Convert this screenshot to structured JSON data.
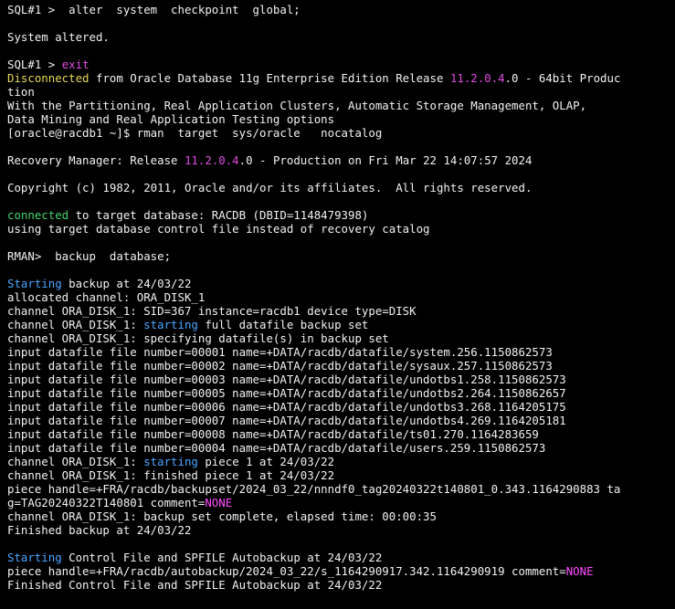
{
  "palette": {
    "background": "#000000",
    "text": "#f2f2f2",
    "yellow": "#e6d85a",
    "magenta": "#e04be0",
    "green": "#48d46f",
    "blue": "#4aa6ff",
    "pink": "#ff4bff"
  },
  "lines": [
    {
      "segments": [
        {
          "text": "SQL#1 >  alter  system  checkpoint  global;"
        }
      ]
    },
    {
      "segments": [
        {
          "text": ""
        }
      ]
    },
    {
      "segments": [
        {
          "text": "System altered."
        }
      ]
    },
    {
      "segments": [
        {
          "text": ""
        }
      ]
    },
    {
      "segments": [
        {
          "text": "SQL#1 > "
        },
        {
          "text": "exit",
          "cls": "m"
        }
      ]
    },
    {
      "segments": [
        {
          "text": "Disconnected",
          "cls": "y"
        },
        {
          "text": " from Oracle Database 11g Enterprise Edition Release "
        },
        {
          "text": "11.2.0.4",
          "cls": "m"
        },
        {
          "text": ".0 - 64bit Produc"
        }
      ]
    },
    {
      "segments": [
        {
          "text": "tion"
        }
      ]
    },
    {
      "segments": [
        {
          "text": "With the Partitioning, Real Application Clusters, Automatic Storage Management, OLAP,"
        }
      ]
    },
    {
      "segments": [
        {
          "text": "Data Mining and Real Application Testing options"
        }
      ]
    },
    {
      "segments": [
        {
          "text": "[oracle@racdb1 ~]$ rman  target  sys/oracle   nocatalog"
        }
      ]
    },
    {
      "segments": [
        {
          "text": ""
        }
      ]
    },
    {
      "segments": [
        {
          "text": "Recovery Manager: Release "
        },
        {
          "text": "11.2.0.4",
          "cls": "m"
        },
        {
          "text": ".0 - Production on Fri Mar 22 14:07:57 2024"
        }
      ]
    },
    {
      "segments": [
        {
          "text": ""
        }
      ]
    },
    {
      "segments": [
        {
          "text": "Copyright (c) 1982, 2011, Oracle and/or its affiliates.  All rights reserved."
        }
      ]
    },
    {
      "segments": [
        {
          "text": ""
        }
      ]
    },
    {
      "segments": [
        {
          "text": "connected",
          "cls": "g"
        },
        {
          "text": " to target database: RACDB (DBID=1148479398)"
        }
      ]
    },
    {
      "segments": [
        {
          "text": "using target database control file instead of recovery catalog"
        }
      ]
    },
    {
      "segments": [
        {
          "text": ""
        }
      ]
    },
    {
      "segments": [
        {
          "text": "RMAN>  backup  database;"
        }
      ]
    },
    {
      "segments": [
        {
          "text": ""
        }
      ]
    },
    {
      "segments": [
        {
          "text": "Starting",
          "cls": "c"
        },
        {
          "text": " backup at 24/03/22"
        }
      ]
    },
    {
      "segments": [
        {
          "text": "allocated channel: ORA_DISK_1"
        }
      ]
    },
    {
      "segments": [
        {
          "text": "channel ORA_DISK_1: SID=367 instance=racdb1 device type=DISK"
        }
      ]
    },
    {
      "segments": [
        {
          "text": "channel ORA_DISK_1: "
        },
        {
          "text": "starting",
          "cls": "c"
        },
        {
          "text": " full datafile backup set"
        }
      ]
    },
    {
      "segments": [
        {
          "text": "channel ORA_DISK_1: specifying datafile(s) in backup set"
        }
      ]
    },
    {
      "segments": [
        {
          "text": "input datafile file number=00001 name=+DATA/racdb/datafile/system.256.1150862573"
        }
      ]
    },
    {
      "segments": [
        {
          "text": "input datafile file number=00002 name=+DATA/racdb/datafile/sysaux.257.1150862573"
        }
      ]
    },
    {
      "segments": [
        {
          "text": "input datafile file number=00003 name=+DATA/racdb/datafile/undotbs1.258.1150862573"
        }
      ]
    },
    {
      "segments": [
        {
          "text": "input datafile file number=00005 name=+DATA/racdb/datafile/undotbs2.264.1150862657"
        }
      ]
    },
    {
      "segments": [
        {
          "text": "input datafile file number=00006 name=+DATA/racdb/datafile/undotbs3.268.1164205175"
        }
      ]
    },
    {
      "segments": [
        {
          "text": "input datafile file number=00007 name=+DATA/racdb/datafile/undotbs4.269.1164205181"
        }
      ]
    },
    {
      "segments": [
        {
          "text": "input datafile file number=00008 name=+DATA/racdb/datafile/ts01.270.1164283659"
        }
      ]
    },
    {
      "segments": [
        {
          "text": "input datafile file number=00004 name=+DATA/racdb/datafile/users.259.1150862573"
        }
      ]
    },
    {
      "segments": [
        {
          "text": "channel ORA_DISK_1: "
        },
        {
          "text": "starting",
          "cls": "c"
        },
        {
          "text": " piece 1 at 24/03/22"
        }
      ]
    },
    {
      "segments": [
        {
          "text": "channel ORA_DISK_1: finished piece 1 at 24/03/22"
        }
      ]
    },
    {
      "segments": [
        {
          "text": "piece handle=+FRA/racdb/backupset/2024_03_22/nnndf0_tag20240322t140801_0.343.1164290883 ta"
        }
      ]
    },
    {
      "segments": [
        {
          "text": "g=TAG20240322T140801 comment="
        },
        {
          "text": "NONE",
          "cls": "p"
        }
      ]
    },
    {
      "segments": [
        {
          "text": "channel ORA_DISK_1: backup set complete, elapsed time: 00:00:35"
        }
      ]
    },
    {
      "segments": [
        {
          "text": "Finished backup at 24/03/22"
        }
      ]
    },
    {
      "segments": [
        {
          "text": ""
        }
      ]
    },
    {
      "segments": [
        {
          "text": "Starting",
          "cls": "c"
        },
        {
          "text": " Control File and SPFILE Autobackup at 24/03/22"
        }
      ]
    },
    {
      "segments": [
        {
          "text": "piece handle=+FRA/racdb/autobackup/2024_03_22/s_1164290917.342.1164290919 comment="
        },
        {
          "text": "NONE",
          "cls": "p"
        }
      ]
    },
    {
      "segments": [
        {
          "text": "Finished Control File and SPFILE Autobackup at 24/03/22"
        }
      ]
    }
  ]
}
